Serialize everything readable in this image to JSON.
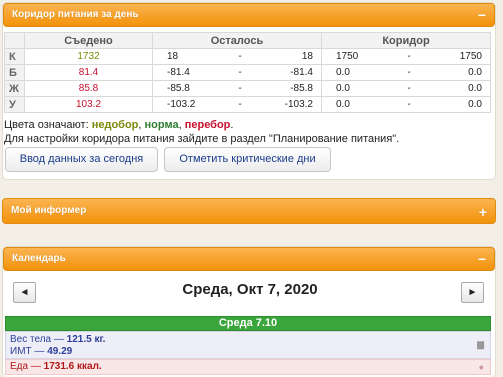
{
  "panel1": {
    "title": "Коридор питания за день",
    "toggle": "−"
  },
  "table": {
    "headers": [
      "Съедено",
      "Осталось",
      "Коридор"
    ],
    "rows": [
      {
        "key": "К",
        "eaten": "1732",
        "rem_a": "18",
        "rem_sep": "-",
        "rem_b": "18",
        "cor_a": "1750",
        "cor_sep": "-",
        "cor_b": "1750"
      },
      {
        "key": "Б",
        "eaten": "81.4",
        "rem_a": "-81.4",
        "rem_sep": "-",
        "rem_b": "-81.4",
        "cor_a": "0.0",
        "cor_sep": "-",
        "cor_b": "0.0"
      },
      {
        "key": "Ж",
        "eaten": "85.8",
        "rem_a": "-85.8",
        "rem_sep": "-",
        "rem_b": "-85.8",
        "cor_a": "0.0",
        "cor_sep": "-",
        "cor_b": "0.0"
      },
      {
        "key": "У",
        "eaten": "103.2",
        "rem_a": "-103.2",
        "rem_sep": "-",
        "rem_b": "-103.2",
        "cor_a": "0.0",
        "cor_sep": "-",
        "cor_b": "0.0"
      }
    ]
  },
  "legend": {
    "prefix": "Цвета означают:",
    "under": "недобор",
    "norm": "норма",
    "over": "перебор",
    "end": "."
  },
  "hint": "Для настройки коридора питания зайдите в раздел \"Планирование питания\".",
  "buttons": {
    "enter_today": "Ввод данных за сегодня",
    "mark_critical": "Отметить критические дни"
  },
  "panel2": {
    "title": "Мой информер",
    "toggle": "+"
  },
  "panel3": {
    "title": "Календарь",
    "toggle": "−"
  },
  "calendar": {
    "prev": "◄",
    "next": "►",
    "date": "Среда, Окт 7, 2020",
    "day_header": "Среда 7.10",
    "weight_label": "Вес тела —",
    "weight_value": "121.5 кг.",
    "bmi_label": "ИМТ —",
    "bmi_value": "49.29",
    "food_label": "Еда —",
    "food_value": "1731.6 ккал."
  },
  "colors": {
    "header_orange": "#f2920a",
    "under": "#7c8a0b",
    "norm": "#2e7d32",
    "over": "#c8102e",
    "day_green": "#3aa53a"
  }
}
